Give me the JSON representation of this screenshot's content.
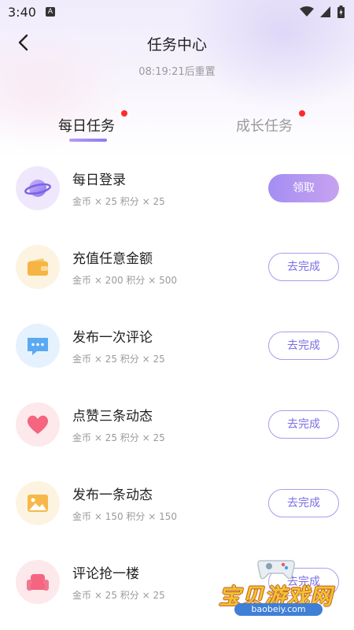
{
  "status_bar": {
    "time": "3:40",
    "notification_letter": "A"
  },
  "header": {
    "title": "任务中心",
    "reset_text": "08:19:21后重置"
  },
  "tabs": [
    {
      "label": "每日任务",
      "active": true,
      "has_dot": true
    },
    {
      "label": "成长任务",
      "active": false,
      "has_dot": true
    }
  ],
  "tasks": [
    {
      "title": "每日登录",
      "reward": "金币 × 25  积分 × 25",
      "button": "领取",
      "icon": "planet-icon",
      "state": "claim"
    },
    {
      "title": "充值任意金额",
      "reward": "金币 × 200  积分 × 500",
      "button": "去完成",
      "icon": "wallet-icon",
      "state": "todo"
    },
    {
      "title": "发布一次评论",
      "reward": "金币 × 25  积分 × 25",
      "button": "去完成",
      "icon": "comment-icon",
      "state": "todo"
    },
    {
      "title": "点赞三条动态",
      "reward": "金币 × 25  积分 × 25",
      "button": "去完成",
      "icon": "heart-icon",
      "state": "todo"
    },
    {
      "title": "发布一条动态",
      "reward": "金币 × 150  积分 × 150",
      "button": "去完成",
      "icon": "image-icon",
      "state": "todo"
    },
    {
      "title": "评论抢一楼",
      "reward": "金币 × 25  积分 × 25",
      "button": "去完成",
      "icon": "sofa-icon",
      "state": "todo"
    }
  ],
  "watermark": {
    "text": "宝贝游戏网",
    "url": "baobeiy.com"
  },
  "colors": {
    "accent": "#8b7cf0",
    "dot": "#ff2a2a",
    "muted": "#9a9a9a"
  }
}
